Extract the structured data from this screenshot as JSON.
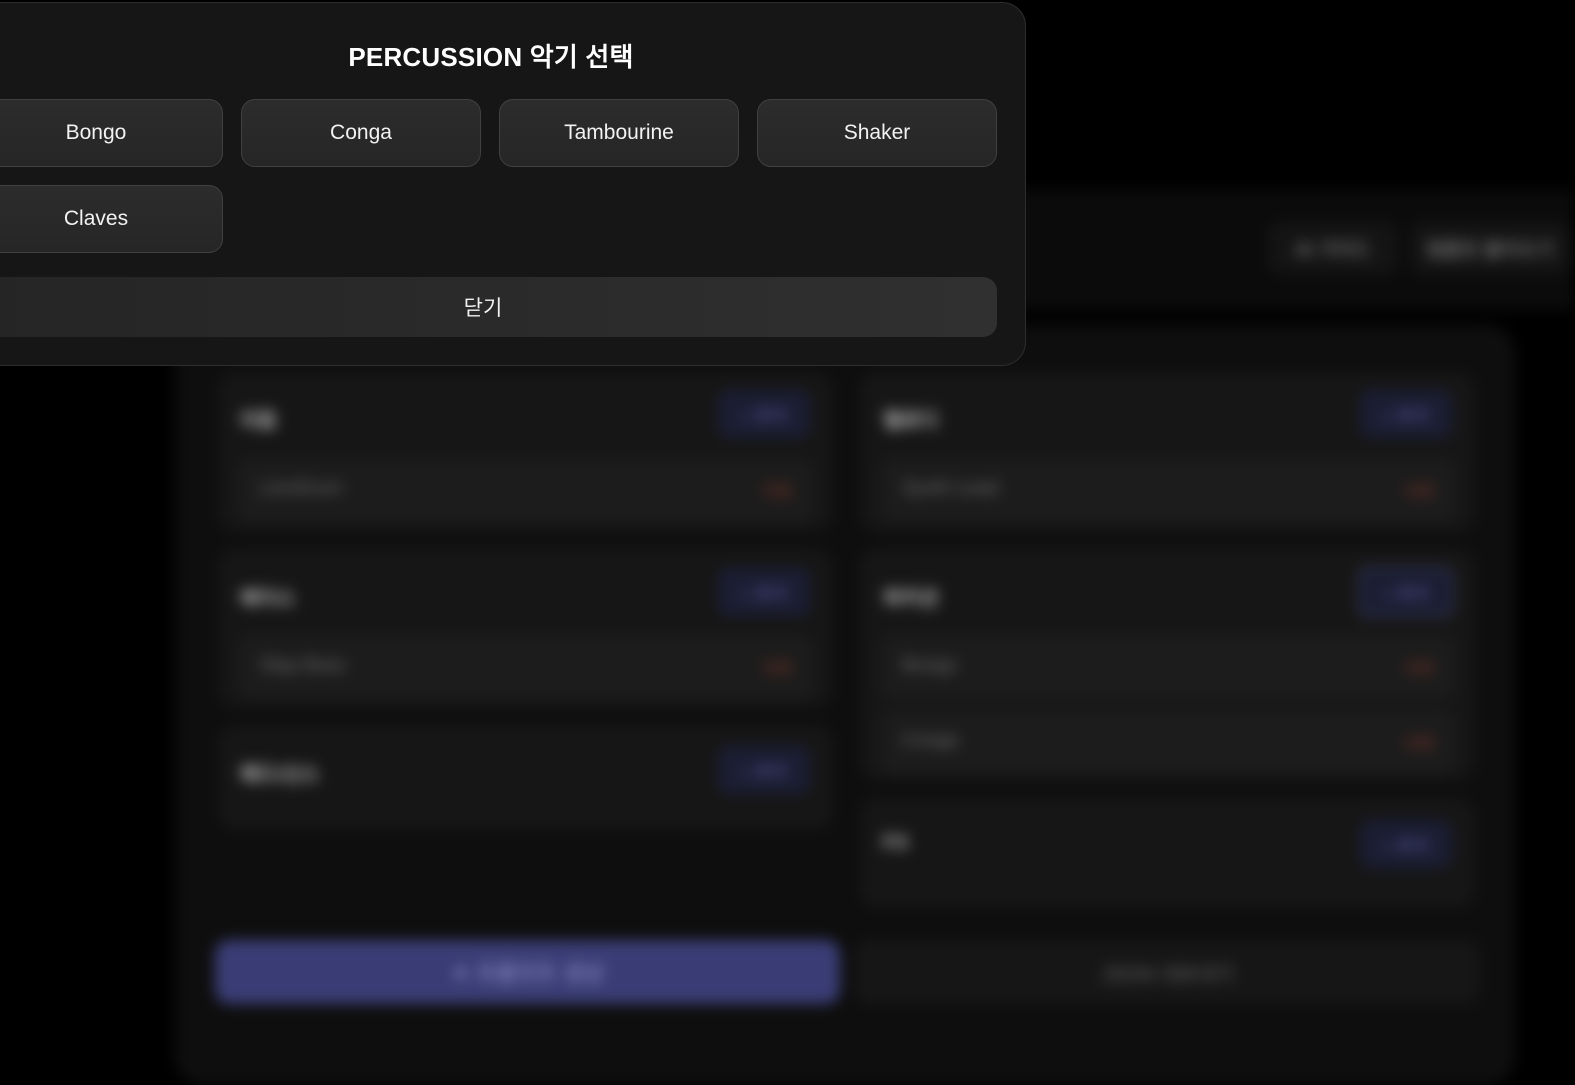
{
  "background": {
    "header_buttons": [
      "AI 가이드",
      "템플릿 불러오기"
    ],
    "sections": [
      {
        "title": "리듬",
        "add_label": "+ 추가",
        "items": [
          {
            "name": "LinnDrum",
            "delete": "삭제"
          }
        ]
      },
      {
        "title": "멜로디",
        "add_label": "+ 추가",
        "items": [
          {
            "name": "Synth Lead",
            "delete": "삭제"
          }
        ]
      },
      {
        "title": "베이스",
        "add_label": "+ 추가",
        "items": [
          {
            "name": "Slap Bass",
            "delete": "삭제"
          }
        ]
      },
      {
        "title": "퍼커션",
        "add_label": "+ 추가",
        "items": [
          {
            "name": "Bongo",
            "delete": "삭제"
          },
          {
            "name": "Conga",
            "delete": "삭제"
          }
        ]
      },
      {
        "title": "패드/신스",
        "add_label": "+ 추가",
        "items": []
      },
      {
        "title": "FX",
        "add_label": "+ 추가",
        "items": []
      }
    ],
    "primary_action": "✦ 프롬프트 생성",
    "secondary_action": "JSON 내보내기"
  },
  "modal": {
    "title": "PERCUSSION 악기 선택",
    "options": [
      "Bongo",
      "Conga",
      "Tambourine",
      "Shaker",
      "Claves"
    ],
    "close_label": "닫기"
  },
  "colors": {
    "modal_bg": "#161616",
    "button_bg": "#2a2a2a",
    "accent": "#3a3d75"
  }
}
